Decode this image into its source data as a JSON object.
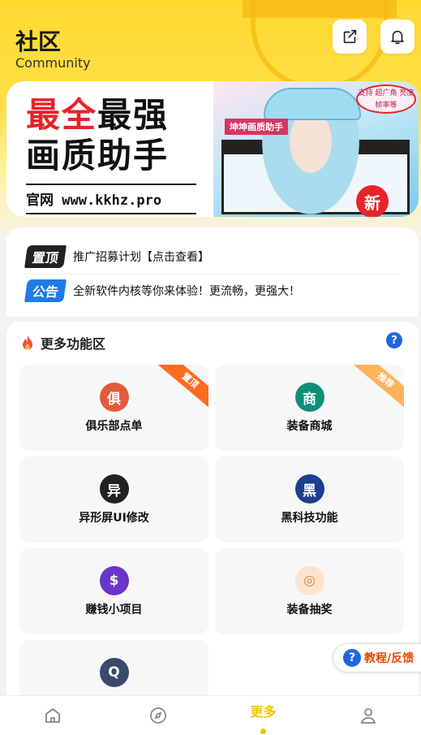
{
  "header": {
    "title": "社区",
    "subtitle": "Community",
    "share_icon": "share-icon",
    "bell_icon": "bell-icon"
  },
  "banner": {
    "line1_red": "最全",
    "line1_black": "最强",
    "line2": "画质助手",
    "site": "官网 www.kkhz.pro",
    "art_title": "坤坤画质助手",
    "tag_text": "支持 超广角 亮度 帧率等",
    "new_badge": "新"
  },
  "notices": [
    {
      "tag": "置顶",
      "text": "推广招募计划【点击查看】"
    },
    {
      "tag": "公告",
      "text": "全新软件内核等你来体验！更流畅，更强大！"
    }
  ],
  "functions": {
    "title": "更多功能区",
    "help": "?",
    "tiles": [
      {
        "label": "俱乐部点单",
        "icon_char": "俱",
        "icon_color": "#e45a3c",
        "ribbon": "置顶"
      },
      {
        "label": "装备商城",
        "icon_char": "商",
        "icon_color": "#0f8f7a",
        "ribbon": "推荐"
      },
      {
        "label": "异形屏UI修改",
        "icon_char": "异",
        "icon_color": "#222222",
        "ribbon": ""
      },
      {
        "label": "黑科技功能",
        "icon_char": "黑",
        "icon_color": "#1d3f8c",
        "ribbon": ""
      },
      {
        "label": "赚钱小项目",
        "icon_char": "$",
        "icon_color": "#6a35c8",
        "ribbon": ""
      },
      {
        "label": "装备抽奖",
        "icon_char": "◎",
        "icon_color": "#f4a35a",
        "ribbon": ""
      },
      {
        "label": "",
        "icon_char": "Q",
        "icon_color": "#3a4a6b",
        "ribbon": ""
      }
    ]
  },
  "feedback": {
    "q": "?",
    "label": "教程/反馈"
  },
  "bottom_nav": {
    "items": [
      {
        "icon": "home-icon"
      },
      {
        "icon": "compass-icon"
      },
      {
        "label": "更多"
      },
      {
        "icon": "user-icon"
      }
    ]
  },
  "colors": {
    "accent": "#f5c400",
    "brand_yellow": "#ffd92e",
    "ribbon_orange": "#ff6b1f",
    "blue": "#1f66e0"
  }
}
